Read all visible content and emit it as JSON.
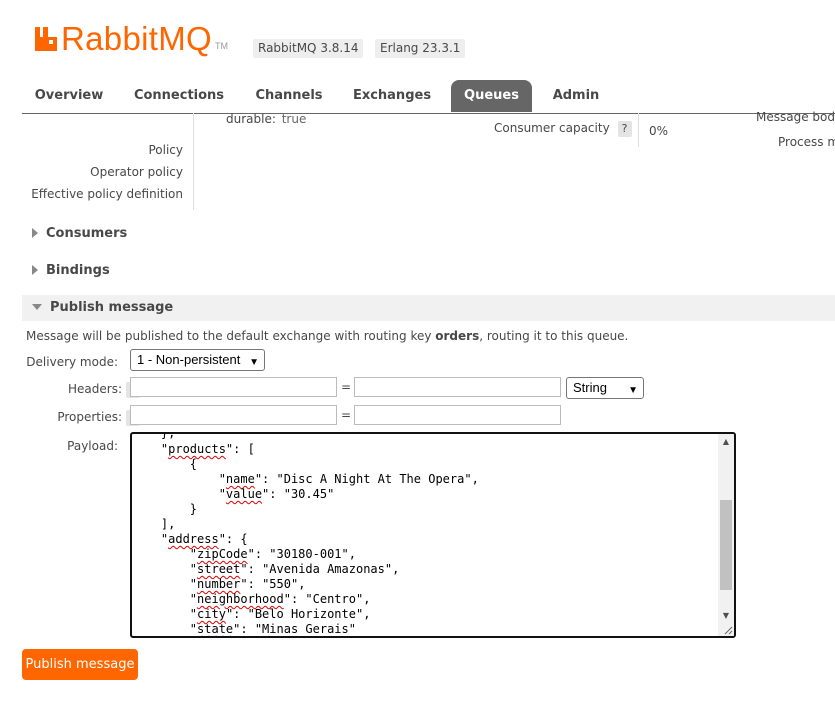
{
  "app": {
    "logo_text": "RabbitMQ",
    "logo_tm": "TM",
    "brand_color": "#ff6600",
    "version": "RabbitMQ 3.8.14",
    "erlang": "Erlang 23.3.1"
  },
  "tabs": [
    {
      "label": "Overview",
      "active": false
    },
    {
      "label": "Connections",
      "active": false
    },
    {
      "label": "Channels",
      "active": false
    },
    {
      "label": "Exchanges",
      "active": false
    },
    {
      "label": "Queues",
      "active": true
    },
    {
      "label": "Admin",
      "active": false
    }
  ],
  "details": {
    "durable_label": "durable:",
    "durable_value": "true",
    "policy_label": "Policy",
    "operator_policy_label": "Operator policy",
    "effective_policy_label": "Effective policy definition",
    "consumer_capacity_label": "Consumer capacity",
    "consumer_capacity_help": "?",
    "consumer_capacity_value": "0%",
    "message_body_label": "Message body",
    "process_memory_label": "Process m"
  },
  "sections": {
    "consumers": "Consumers",
    "bindings": "Bindings",
    "publish": "Publish message"
  },
  "publish": {
    "info_prefix": "Message will be published to the default exchange with routing key ",
    "routing_key": "orders",
    "info_suffix": ", routing it to this queue.",
    "delivery_mode_label": "Delivery mode:",
    "delivery_mode_value": "1 - Non-persistent",
    "headers_label": "Headers:",
    "properties_label": "Properties:",
    "help": "?",
    "equals": "=",
    "header_type_value": "String",
    "payload_label": "Payload:",
    "payload_lines": [
      "    },",
      "    \"products\": [",
      "        {",
      "            \"name\": \"Disc A Night At The Opera\",",
      "            \"value\": \"30.45\"",
      "        }",
      "    ],",
      "    \"address\": {",
      "        \"zipCode\": \"30180-001\",",
      "        \"street\": \"Avenida Amazonas\",",
      "        \"number\": \"550\",",
      "        \"neighborhood\": \"Centro\",",
      "        \"city\": \"Belo Horizonte\",",
      "        \"state\": \"Minas Gerais\""
    ],
    "submit_label": "Publish message"
  }
}
